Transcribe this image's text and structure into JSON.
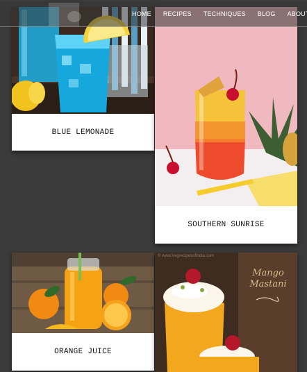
{
  "nav": {
    "items": [
      "HOME",
      "RECIPES",
      "TECHNIQUES",
      "BLOG",
      "ABOUT US"
    ]
  },
  "cards": [
    {
      "title": "BLUE LEMONADE"
    },
    {
      "title": "SOUTHERN SUNRISE"
    },
    {
      "title": "ORANGE JUICE"
    },
    {
      "title": "",
      "image_text": "Mango Mastani"
    }
  ],
  "watermark": "© www.Vegrecipesofindia.com",
  "colors": {
    "page_background": "#3b3b3b",
    "caption_background": "#ffffff",
    "nav_text": "#ffffff"
  }
}
